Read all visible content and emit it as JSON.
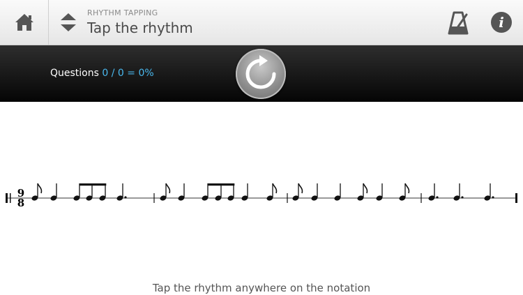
{
  "header": {
    "section_label": "RHYTHM TAPPING",
    "title": "Tap the rhythm"
  },
  "icons": {
    "home": "home-icon",
    "sort": "sort-up-down-icon",
    "metronome": "metronome-icon",
    "info": "info-icon",
    "refresh": "refresh-icon"
  },
  "info_glyph": "i",
  "status_bar": {
    "questions_label": "Questions",
    "score": "0 / 0 = 0%"
  },
  "notation": {
    "time_signature": {
      "top": "9",
      "bottom": "8"
    },
    "measures": [
      [
        "8",
        "q",
        "8",
        "8",
        "8",
        "q."
      ],
      [
        "8",
        "q",
        "8",
        "8",
        "8",
        "q",
        "8"
      ],
      [
        "8",
        "q",
        "q",
        "8",
        "q",
        "8"
      ],
      [
        "q.",
        "q.",
        "q."
      ]
    ]
  },
  "hint": "Tap the rhythm anywhere on the notation",
  "colors": {
    "accent": "#49b8ee",
    "header_text": "#4a4a4a",
    "bar_bg": "#111111"
  }
}
